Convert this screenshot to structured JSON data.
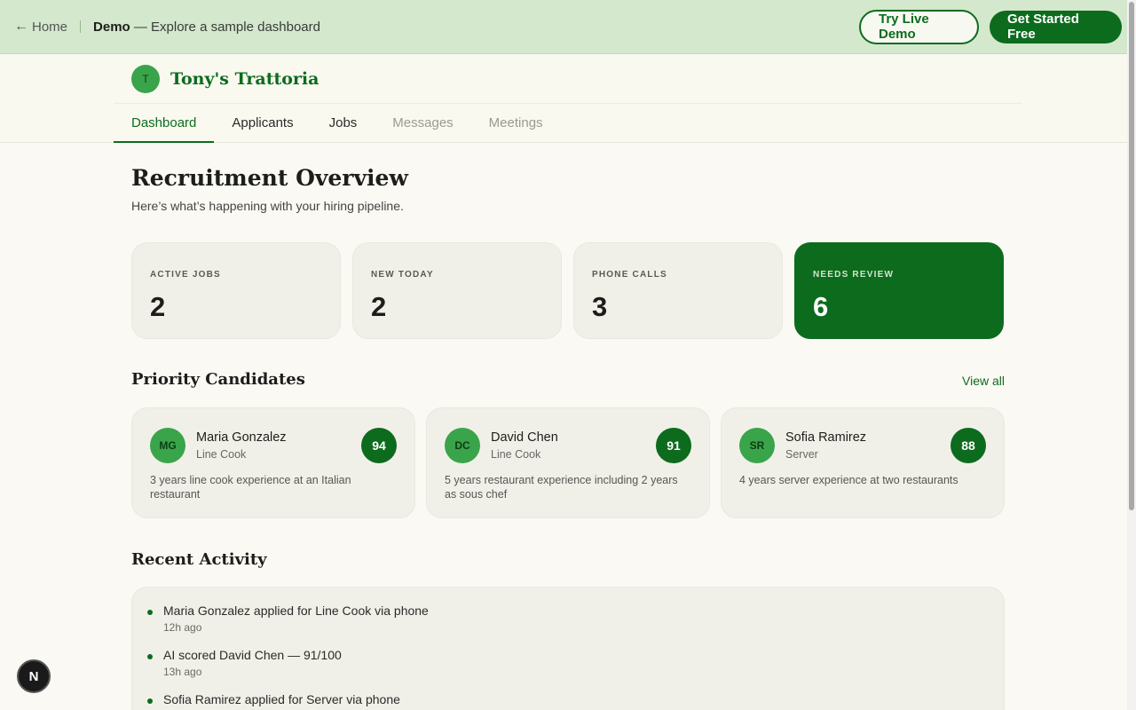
{
  "banner": {
    "home_label": "Home",
    "demo_label": "Demo",
    "demo_desc": " — Explore a sample dashboard",
    "try_demo": "Try Live Demo",
    "get_started": "Get Started Free"
  },
  "brand": {
    "initial": "T",
    "name": "Tony's Trattoria"
  },
  "tabs": [
    {
      "label": "Dashboard",
      "state": "active"
    },
    {
      "label": "Applicants",
      "state": "normal"
    },
    {
      "label": "Jobs",
      "state": "normal"
    },
    {
      "label": "Messages",
      "state": "muted"
    },
    {
      "label": "Meetings",
      "state": "muted"
    }
  ],
  "overview": {
    "title": "Recruitment Overview",
    "subtitle": "Here’s what’s happening with your hiring pipeline."
  },
  "stats": [
    {
      "label": "ACTIVE JOBS",
      "value": "2"
    },
    {
      "label": "NEW TODAY",
      "value": "2"
    },
    {
      "label": "PHONE CALLS",
      "value": "3"
    },
    {
      "label": "NEEDS REVIEW",
      "value": "6"
    }
  ],
  "priority": {
    "title": "Priority Candidates",
    "view_all": "View all",
    "candidates": [
      {
        "initials": "MG",
        "name": "Maria Gonzalez",
        "role": "Line Cook",
        "score": "94",
        "desc": "3 years line cook experience at an Italian restaurant"
      },
      {
        "initials": "DC",
        "name": "David Chen",
        "role": "Line Cook",
        "score": "91",
        "desc": "5 years restaurant experience including 2 years as sous chef"
      },
      {
        "initials": "SR",
        "name": "Sofia Ramirez",
        "role": "Server",
        "score": "88",
        "desc": "4 years server experience at two restaurants"
      }
    ]
  },
  "activity": {
    "title": "Recent Activity",
    "items": [
      {
        "text": "Maria Gonzalez applied for Line Cook via phone",
        "time": "12h ago"
      },
      {
        "text": "AI scored David Chen — 91/100",
        "time": "13h ago"
      },
      {
        "text": "Sofia Ramirez applied for Server via phone",
        "time": ""
      }
    ]
  },
  "fab": {
    "label": "N"
  },
  "colors": {
    "accent": "#0d6b1e",
    "avatar": "#3aa44a",
    "banner": "#d3e8cc"
  }
}
